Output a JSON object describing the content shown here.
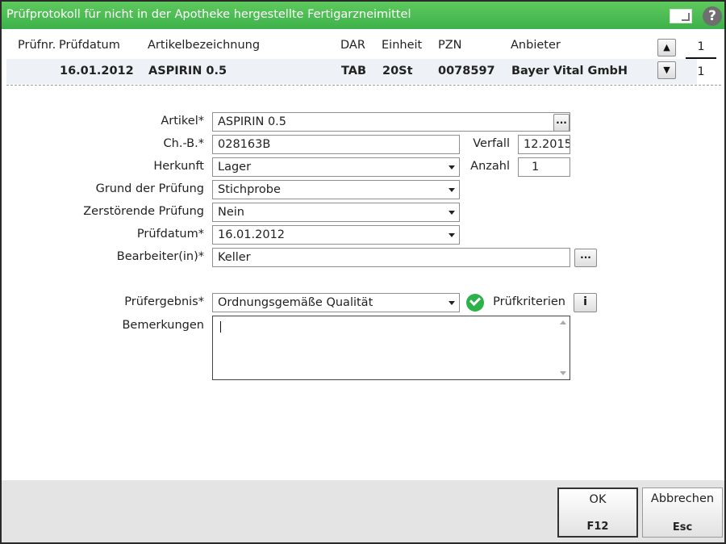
{
  "window": {
    "title": "Prüfprotokoll für nicht in der Apotheke hergestellte Fertigarzneimittel",
    "help_label": "?"
  },
  "list": {
    "headers": {
      "pruefnr": "Prüfnr.",
      "pruefdatum": "Prüfdatum",
      "artikel": "Artikelbezeichnung",
      "dar": "DAR",
      "einheit": "Einheit",
      "pzn": "PZN",
      "anbieter": "Anbieter"
    },
    "row": {
      "pruefnr": "",
      "pruefdatum": "16.01.2012",
      "artikel": "ASPIRIN 0.5",
      "dar": "TAB",
      "einheit": "20St",
      "pzn": "0078597",
      "anbieter": "Bayer Vital GmbH"
    },
    "nav": {
      "up_glyph": "▲",
      "down_glyph": "▼",
      "current": "1",
      "total": "1"
    }
  },
  "form": {
    "artikel": {
      "label": "Artikel*",
      "value": "ASPIRIN 0.5",
      "button": "..."
    },
    "charge": {
      "label": "Ch.-B.*",
      "value": "028163B"
    },
    "verfall": {
      "label": "Verfall",
      "value": "12.2015"
    },
    "herkunft": {
      "label": "Herkunft",
      "value": "Lager"
    },
    "anzahl": {
      "label": "Anzahl",
      "value": "1"
    },
    "grund": {
      "label": "Grund der Prüfung",
      "value": "Stichprobe"
    },
    "zerstoerend": {
      "label": "Zerstörende Prüfung",
      "value": "Nein"
    },
    "pruefdatum": {
      "label": "Prüfdatum*",
      "value": "16.01.2012"
    },
    "bearbeiter": {
      "label": "Bearbeiter(in)*",
      "value": "Keller",
      "button": "..."
    },
    "ergebnis": {
      "label": "Prüfergebnis*",
      "value": "Ordnungsgemäße Qualität",
      "status_icon": "check-circle-icon",
      "status_color": "#2db24a"
    },
    "kriterien": {
      "label": "Prüfkriterien",
      "button": "i"
    },
    "bemerkungen": {
      "label": "Bemerkungen",
      "value": ""
    }
  },
  "footer": {
    "ok": {
      "label": "OK",
      "key": "F12"
    },
    "cancel": {
      "label": "Abbrechen",
      "key": "Esc"
    }
  },
  "colors": {
    "titlebar": "#3cb24a",
    "selected_row": "#eef1f5",
    "footer": "#e4e4e4"
  }
}
